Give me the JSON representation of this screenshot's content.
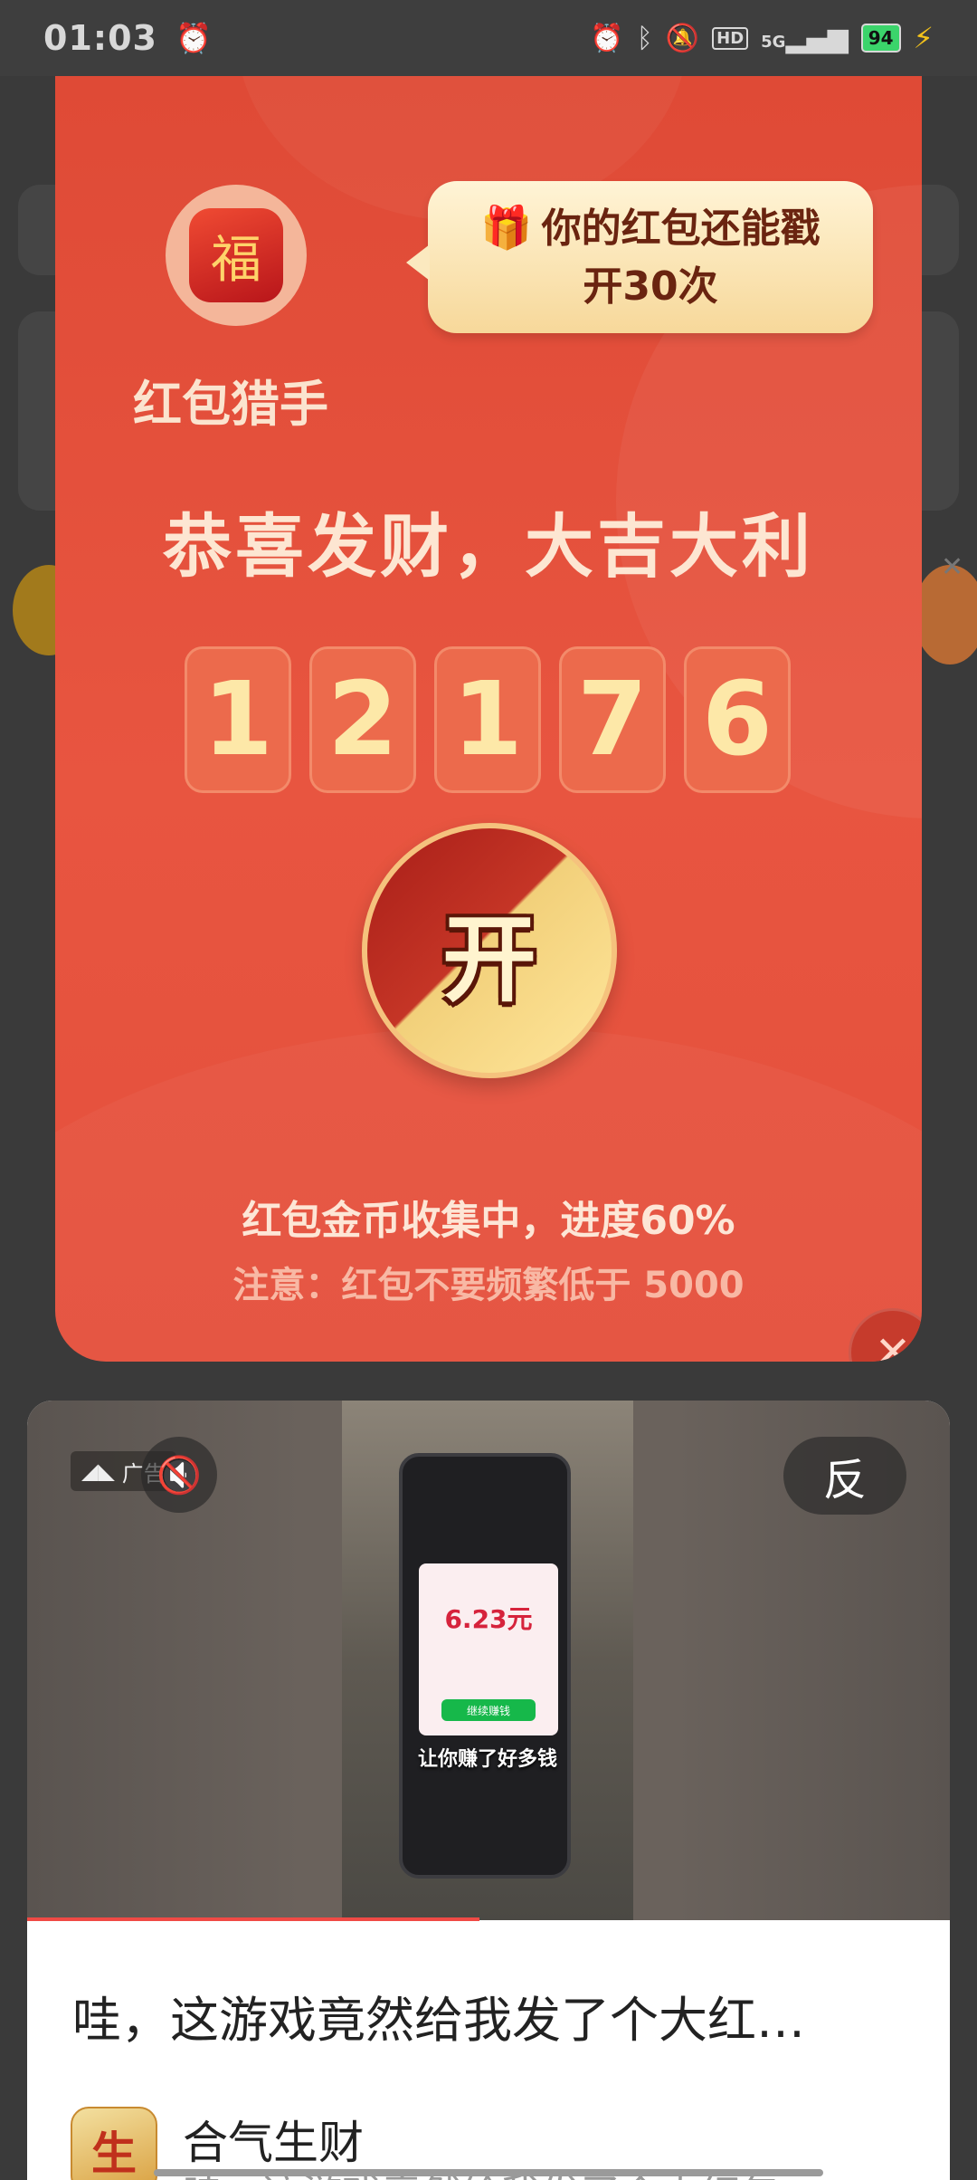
{
  "status_bar": {
    "time": "01:03",
    "network": "5G",
    "battery": "94",
    "hd": "HD"
  },
  "modal": {
    "app_name": "红包猎手",
    "bubble_line1": "你的红包还能戳",
    "bubble_line2": "开30次",
    "headline": "恭喜发财，大吉大利",
    "digits": [
      "1",
      "2",
      "1",
      "7",
      "6"
    ],
    "open_label": "开",
    "progress_text": "红包金币收集中，进度60%",
    "notice_text": "注意：红包不要频繁低于 5000",
    "close_label": "✕"
  },
  "ad": {
    "tag_label": "广告",
    "report_label": "反",
    "video_amount": "6.23元",
    "video_button": "继续赚钱",
    "video_caption": "让你赚了好多钱",
    "title": "哇，这游戏竟然给我发了个大红…",
    "app_name": "合气生财",
    "app_icon_text": "生",
    "subtitle": "哇，这游戏竟然给我发了个大红包"
  },
  "colors": {
    "modal_red": "#e4503c",
    "accent_gold": "#ffe69b",
    "progress_red": "#f04a45"
  }
}
